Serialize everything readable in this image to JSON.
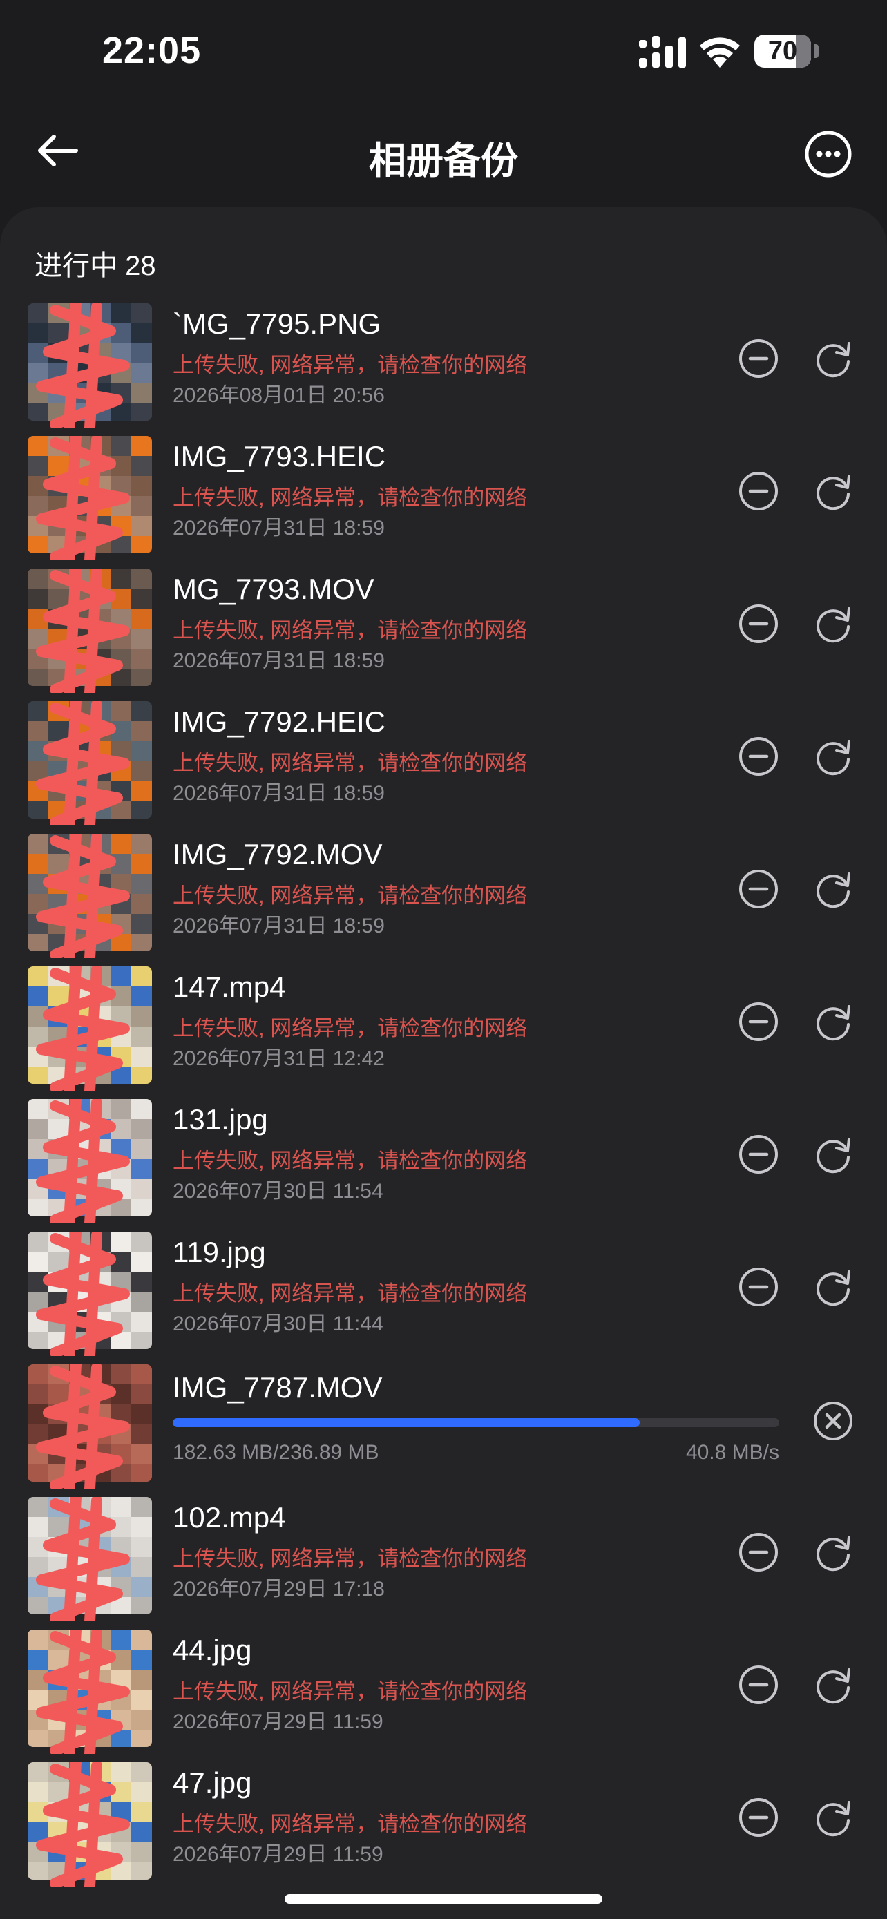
{
  "status_bar": {
    "time": "22:05",
    "battery": "70"
  },
  "header": {
    "title": "相册备份"
  },
  "section": {
    "label": "进行中 28"
  },
  "items": [
    {
      "name": "`MG_7795.PNG",
      "error": "上传失败, 网络异常，请检查你的网络",
      "date": "2026年08月01日 20:56"
    },
    {
      "name": "IMG_7793.HEIC",
      "error": "上传失败, 网络异常，请检查你的网络",
      "date": "2026年07月31日 18:59"
    },
    {
      "name": " MG_7793.MOV",
      "error": "上传失败, 网络异常，请检查你的网络",
      "date": "2026年07月31日 18:59"
    },
    {
      "name": "IMG_7792.HEIC",
      "error": "上传失败, 网络异常，请检查你的网络",
      "date": "2026年07月31日 18:59"
    },
    {
      "name": "IMG_7792.MOV",
      "error": "上传失败, 网络异常，请检查你的网络",
      "date": "2026年07月31日 18:59"
    },
    {
      "name": "147.mp4",
      "error": "上传失败, 网络异常，请检查你的网络",
      "date": "2026年07月31日 12:42"
    },
    {
      "name": "131.jpg",
      "error": "上传失败, 网络异常，请检查你的网络",
      "date": "2026年07月30日 11:54"
    },
    {
      "name": "119.jpg",
      "error": "上传失败, 网络异常，请检查你的网络",
      "date": "2026年07月30日 11:44"
    },
    {
      "name": "IMG_7787.MOV",
      "uploading": true,
      "progress": 0.77,
      "size": "182.63 MB/236.89 MB",
      "speed": "40.8 MB/s"
    },
    {
      "name": "102.mp4",
      "error": "上传失败, 网络异常，请检查你的网络",
      "date": "2026年07月29日 17:18"
    },
    {
      "name": "44.jpg",
      "error": "上传失败, 网络异常，请检查你的网络",
      "date": "2026年07月29日 11:59"
    },
    {
      "name": "47.jpg",
      "error": "上传失败, 网络异常，请检查你的网络",
      "date": "2026年07月29日 11:59"
    }
  ],
  "colors": {
    "error": "#d9534f",
    "progress": "#2f6bff",
    "background": "#1c1c1e",
    "sheet": "#242427",
    "scribble": "#f25a5a"
  }
}
